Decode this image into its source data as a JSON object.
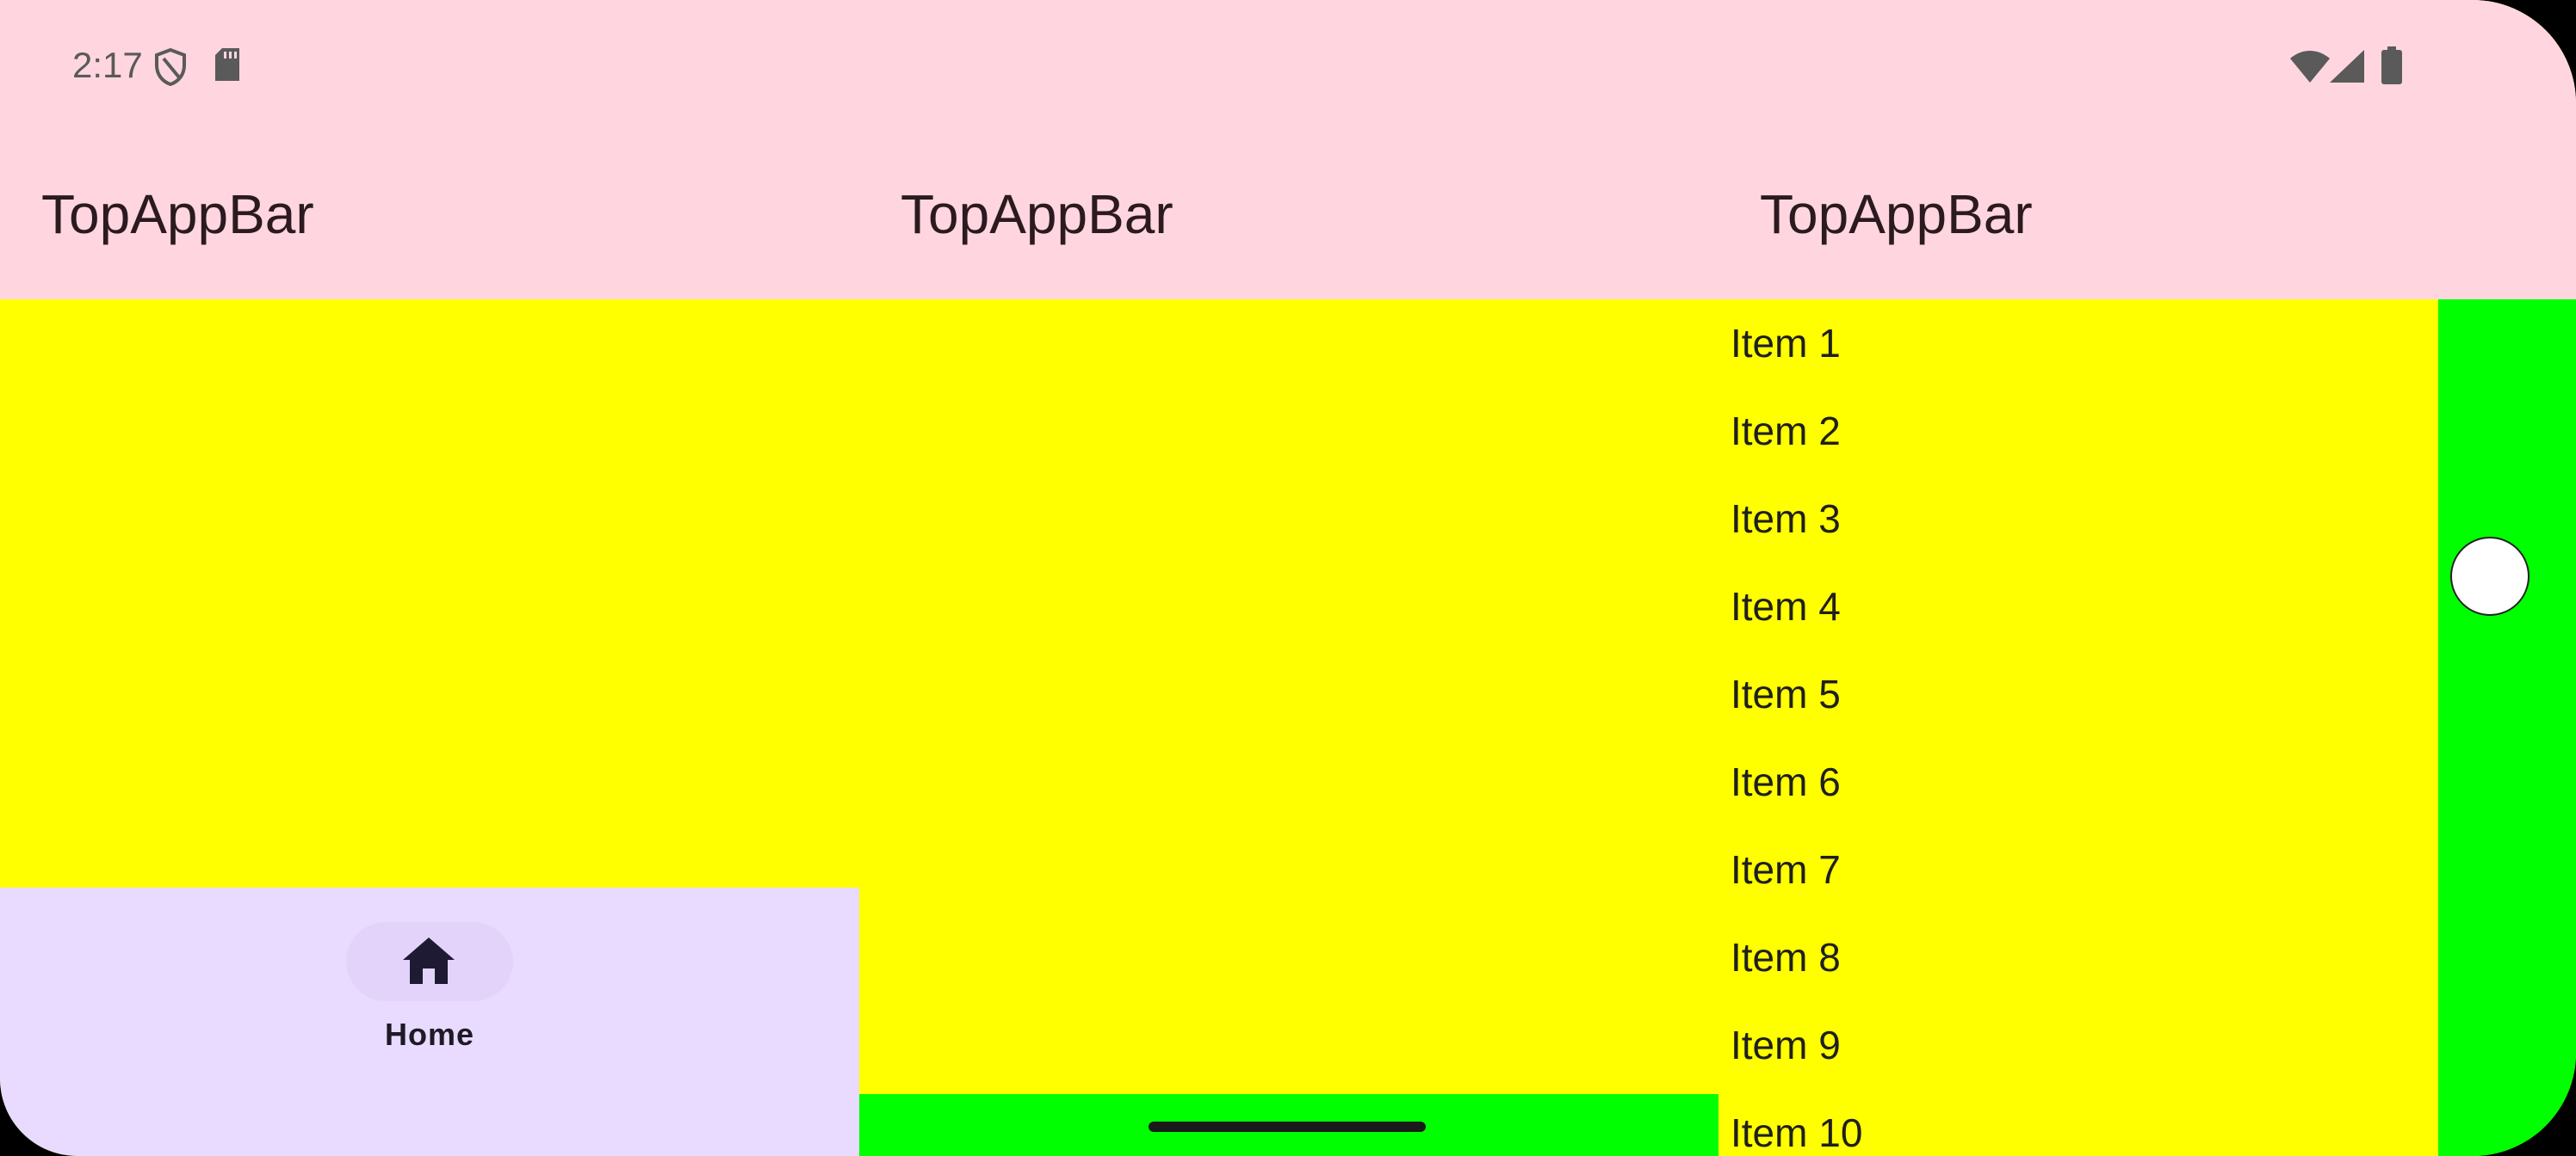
{
  "status_bar": {
    "time": "2:17",
    "left_icons": [
      "shield-icon",
      "sd-card-icon"
    ],
    "right_icons": [
      "wifi-icon",
      "cellular-signal-icon",
      "battery-icon"
    ]
  },
  "panes": [
    {
      "title": "TopAppBar"
    },
    {
      "title": "TopAppBar"
    },
    {
      "title": "TopAppBar"
    }
  ],
  "bottom_nav": {
    "items": [
      {
        "icon": "home-icon",
        "label": "Home"
      }
    ]
  },
  "list": {
    "items": [
      "Item 1",
      "Item 2",
      "Item 3",
      "Item 4",
      "Item 5",
      "Item 6",
      "Item 7",
      "Item 8",
      "Item 9",
      "Item 10"
    ]
  },
  "colors": {
    "app_bar": "#ffd6e0",
    "content": "#ffff00",
    "bottom_nav": "#e8dbff",
    "accent_green": "#00ff00"
  }
}
